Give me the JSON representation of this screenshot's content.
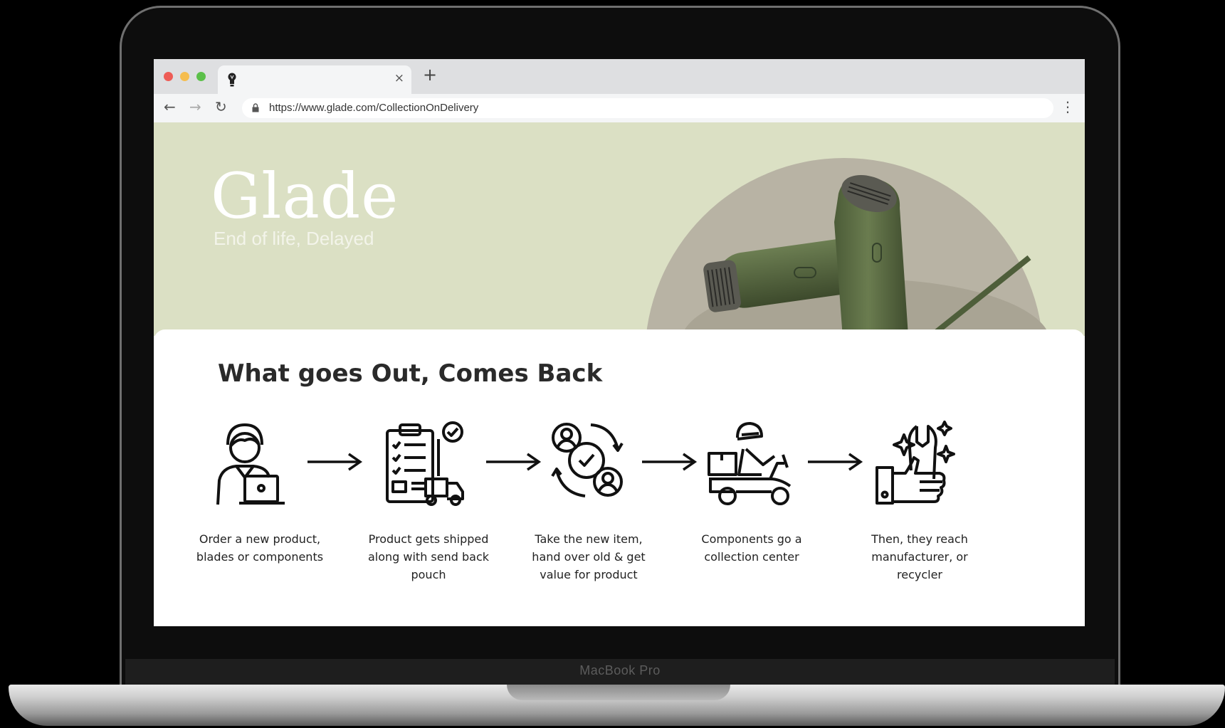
{
  "browser": {
    "tab_close": "×",
    "new_tab": "+",
    "back": "←",
    "forward": "→",
    "reload": "↻",
    "url": "https://www.glade.com/CollectionOnDelivery",
    "menu": "⋮"
  },
  "laptop": {
    "model_label": "MacBook Pro"
  },
  "hero": {
    "brand": "Glade",
    "tagline": "End of life, Delayed",
    "background_color": "#dbe0c4",
    "product_color": "#5d6e45"
  },
  "process": {
    "title": "What goes Out, Comes Back",
    "steps": [
      {
        "icon": "person-laptop-icon",
        "caption": "Order a new product, blades or components"
      },
      {
        "icon": "checklist-delivery-icon",
        "caption": "Product gets shipped along with send back pouch"
      },
      {
        "icon": "exchange-check-icon",
        "caption": "Take the new item, hand over old & get value for product"
      },
      {
        "icon": "delivery-scooter-icon",
        "caption": "Components go a collection center"
      },
      {
        "icon": "thumbs-up-wrench-icon",
        "caption": "Then, they reach manufacturer, or recycler"
      }
    ]
  }
}
